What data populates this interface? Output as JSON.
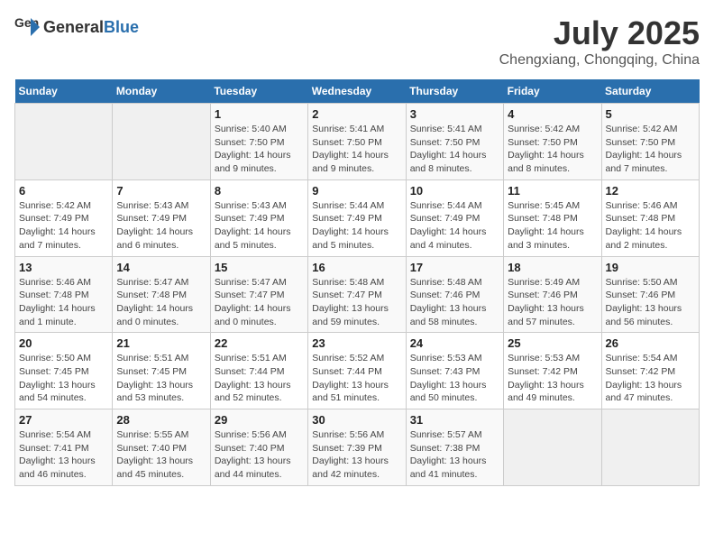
{
  "header": {
    "logo_general": "General",
    "logo_blue": "Blue",
    "month_year": "July 2025",
    "location": "Chengxiang, Chongqing, China"
  },
  "days_of_week": [
    "Sunday",
    "Monday",
    "Tuesday",
    "Wednesday",
    "Thursday",
    "Friday",
    "Saturday"
  ],
  "weeks": [
    [
      {
        "day": "",
        "info": ""
      },
      {
        "day": "",
        "info": ""
      },
      {
        "day": "1",
        "info": "Sunrise: 5:40 AM\nSunset: 7:50 PM\nDaylight: 14 hours and 9 minutes."
      },
      {
        "day": "2",
        "info": "Sunrise: 5:41 AM\nSunset: 7:50 PM\nDaylight: 14 hours and 9 minutes."
      },
      {
        "day": "3",
        "info": "Sunrise: 5:41 AM\nSunset: 7:50 PM\nDaylight: 14 hours and 8 minutes."
      },
      {
        "day": "4",
        "info": "Sunrise: 5:42 AM\nSunset: 7:50 PM\nDaylight: 14 hours and 8 minutes."
      },
      {
        "day": "5",
        "info": "Sunrise: 5:42 AM\nSunset: 7:50 PM\nDaylight: 14 hours and 7 minutes."
      }
    ],
    [
      {
        "day": "6",
        "info": "Sunrise: 5:42 AM\nSunset: 7:49 PM\nDaylight: 14 hours and 7 minutes."
      },
      {
        "day": "7",
        "info": "Sunrise: 5:43 AM\nSunset: 7:49 PM\nDaylight: 14 hours and 6 minutes."
      },
      {
        "day": "8",
        "info": "Sunrise: 5:43 AM\nSunset: 7:49 PM\nDaylight: 14 hours and 5 minutes."
      },
      {
        "day": "9",
        "info": "Sunrise: 5:44 AM\nSunset: 7:49 PM\nDaylight: 14 hours and 5 minutes."
      },
      {
        "day": "10",
        "info": "Sunrise: 5:44 AM\nSunset: 7:49 PM\nDaylight: 14 hours and 4 minutes."
      },
      {
        "day": "11",
        "info": "Sunrise: 5:45 AM\nSunset: 7:48 PM\nDaylight: 14 hours and 3 minutes."
      },
      {
        "day": "12",
        "info": "Sunrise: 5:46 AM\nSunset: 7:48 PM\nDaylight: 14 hours and 2 minutes."
      }
    ],
    [
      {
        "day": "13",
        "info": "Sunrise: 5:46 AM\nSunset: 7:48 PM\nDaylight: 14 hours and 1 minute."
      },
      {
        "day": "14",
        "info": "Sunrise: 5:47 AM\nSunset: 7:48 PM\nDaylight: 14 hours and 0 minutes."
      },
      {
        "day": "15",
        "info": "Sunrise: 5:47 AM\nSunset: 7:47 PM\nDaylight: 14 hours and 0 minutes."
      },
      {
        "day": "16",
        "info": "Sunrise: 5:48 AM\nSunset: 7:47 PM\nDaylight: 13 hours and 59 minutes."
      },
      {
        "day": "17",
        "info": "Sunrise: 5:48 AM\nSunset: 7:46 PM\nDaylight: 13 hours and 58 minutes."
      },
      {
        "day": "18",
        "info": "Sunrise: 5:49 AM\nSunset: 7:46 PM\nDaylight: 13 hours and 57 minutes."
      },
      {
        "day": "19",
        "info": "Sunrise: 5:50 AM\nSunset: 7:46 PM\nDaylight: 13 hours and 56 minutes."
      }
    ],
    [
      {
        "day": "20",
        "info": "Sunrise: 5:50 AM\nSunset: 7:45 PM\nDaylight: 13 hours and 54 minutes."
      },
      {
        "day": "21",
        "info": "Sunrise: 5:51 AM\nSunset: 7:45 PM\nDaylight: 13 hours and 53 minutes."
      },
      {
        "day": "22",
        "info": "Sunrise: 5:51 AM\nSunset: 7:44 PM\nDaylight: 13 hours and 52 minutes."
      },
      {
        "day": "23",
        "info": "Sunrise: 5:52 AM\nSunset: 7:44 PM\nDaylight: 13 hours and 51 minutes."
      },
      {
        "day": "24",
        "info": "Sunrise: 5:53 AM\nSunset: 7:43 PM\nDaylight: 13 hours and 50 minutes."
      },
      {
        "day": "25",
        "info": "Sunrise: 5:53 AM\nSunset: 7:42 PM\nDaylight: 13 hours and 49 minutes."
      },
      {
        "day": "26",
        "info": "Sunrise: 5:54 AM\nSunset: 7:42 PM\nDaylight: 13 hours and 47 minutes."
      }
    ],
    [
      {
        "day": "27",
        "info": "Sunrise: 5:54 AM\nSunset: 7:41 PM\nDaylight: 13 hours and 46 minutes."
      },
      {
        "day": "28",
        "info": "Sunrise: 5:55 AM\nSunset: 7:40 PM\nDaylight: 13 hours and 45 minutes."
      },
      {
        "day": "29",
        "info": "Sunrise: 5:56 AM\nSunset: 7:40 PM\nDaylight: 13 hours and 44 minutes."
      },
      {
        "day": "30",
        "info": "Sunrise: 5:56 AM\nSunset: 7:39 PM\nDaylight: 13 hours and 42 minutes."
      },
      {
        "day": "31",
        "info": "Sunrise: 5:57 AM\nSunset: 7:38 PM\nDaylight: 13 hours and 41 minutes."
      },
      {
        "day": "",
        "info": ""
      },
      {
        "day": "",
        "info": ""
      }
    ]
  ]
}
